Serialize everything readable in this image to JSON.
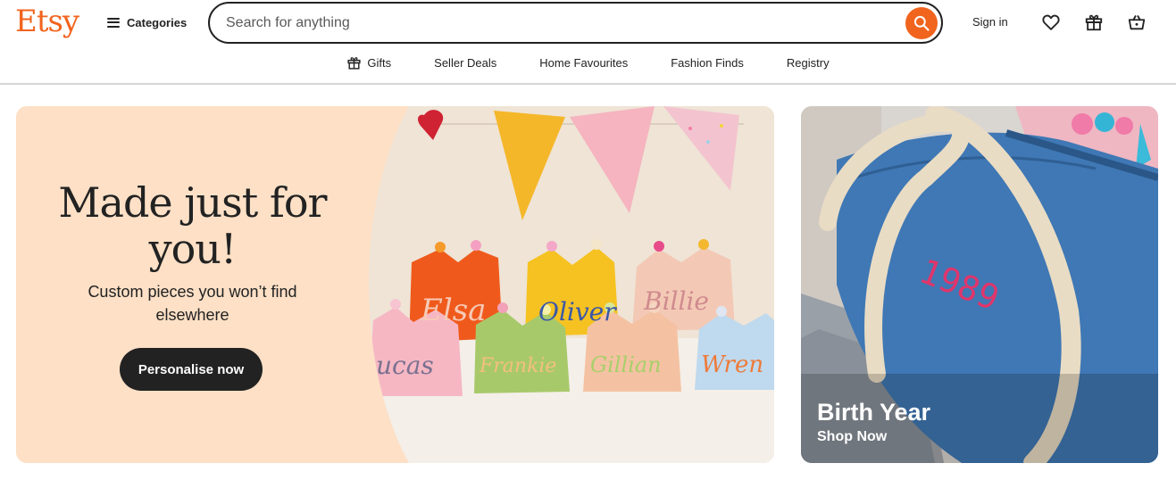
{
  "header": {
    "logo": "Etsy",
    "categories_label": "Categories",
    "search_placeholder": "Search for anything",
    "search_value": "",
    "signin_label": "Sign in"
  },
  "subnav": {
    "items": [
      {
        "label": "Gifts",
        "icon": "gift-icon"
      },
      {
        "label": "Seller Deals"
      },
      {
        "label": "Home Favourites"
      },
      {
        "label": "Fashion Finds"
      },
      {
        "label": "Registry"
      }
    ]
  },
  "hero": {
    "title": "Made just for you!",
    "subtitle": "Custom pieces you won’t find elsewhere",
    "button_label": "Personalise now",
    "bg_color": "#fde0c6",
    "crown_names": [
      "Elsa",
      "Oliver",
      "Billie",
      "ucas",
      "Frankie",
      "Gillian",
      "Wren"
    ]
  },
  "side_card": {
    "title": "Birth Year",
    "link_label": "Shop Now",
    "embroidery": "1989"
  },
  "colors": {
    "accent": "#f1641e",
    "dark": "#222222"
  }
}
